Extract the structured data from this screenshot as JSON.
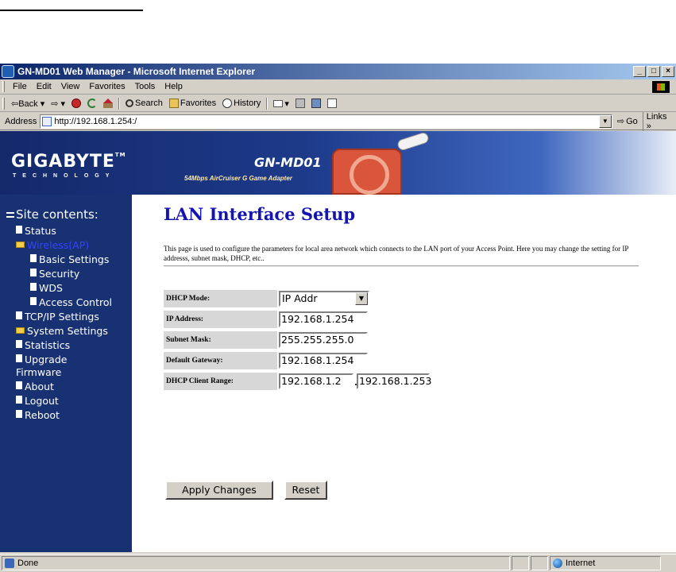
{
  "window": {
    "title": "GN-MD01 Web Manager - Microsoft Internet Explorer",
    "controls": [
      "_",
      "□",
      "×"
    ]
  },
  "menu": [
    "File",
    "Edit",
    "View",
    "Favorites",
    "Tools",
    "Help"
  ],
  "toolbar": {
    "back": "⇦Back ▾",
    "forward": "⇨ ▾",
    "search": "Search",
    "favorites": "Favorites",
    "history": "History"
  },
  "address": {
    "label": "Address",
    "url": "http://192.168.1.254:/",
    "go": "Go",
    "links": "Links »"
  },
  "banner": {
    "brand": "GIGABYTE",
    "brand_tm": "TM",
    "brand_sub": "TECHNOLOGY",
    "product": "GN-MD01",
    "product_sub": "54Mbps AirCruiser G Game Adapter"
  },
  "sidebar": {
    "title": "Site contents:",
    "items": [
      {
        "label": "Status"
      },
      {
        "label": "Wireless(AP)"
      },
      {
        "label": "Basic Settings"
      },
      {
        "label": "Security"
      },
      {
        "label": "WDS"
      },
      {
        "label": "Access Control"
      },
      {
        "label": "TCP/IP Settings"
      },
      {
        "label": "System Settings"
      },
      {
        "label": "Statistics"
      },
      {
        "label": "Upgrade"
      },
      {
        "label": "Firmware"
      },
      {
        "label": "About"
      },
      {
        "label": "Logout"
      },
      {
        "label": "Reboot"
      }
    ]
  },
  "main": {
    "title": "LAN Interface Setup",
    "description": "This page is used to configure the parameters for local area network which connects to the LAN port of your Access Point. Here you may change the setting for IP addresss, subnet mask, DHCP, etc..",
    "fields": {
      "dhcp_mode": {
        "label": "DHCP Mode:",
        "value": "IP Addr"
      },
      "ip_address": {
        "label": "IP Address:",
        "value": "192.168.1.254"
      },
      "subnet_mask": {
        "label": "Subnet Mask:",
        "value": "255.255.255.0"
      },
      "gateway": {
        "label": "Default Gateway:",
        "value": "192.168.1.254"
      },
      "dhcp_range": {
        "label": "DHCP Client Range:",
        "start": "192.168.1.2",
        "end": "192.168.1.253"
      }
    },
    "apply_label": "Apply Changes",
    "reset_label": "Reset"
  },
  "status": {
    "text": "Done",
    "zone": "Internet"
  }
}
